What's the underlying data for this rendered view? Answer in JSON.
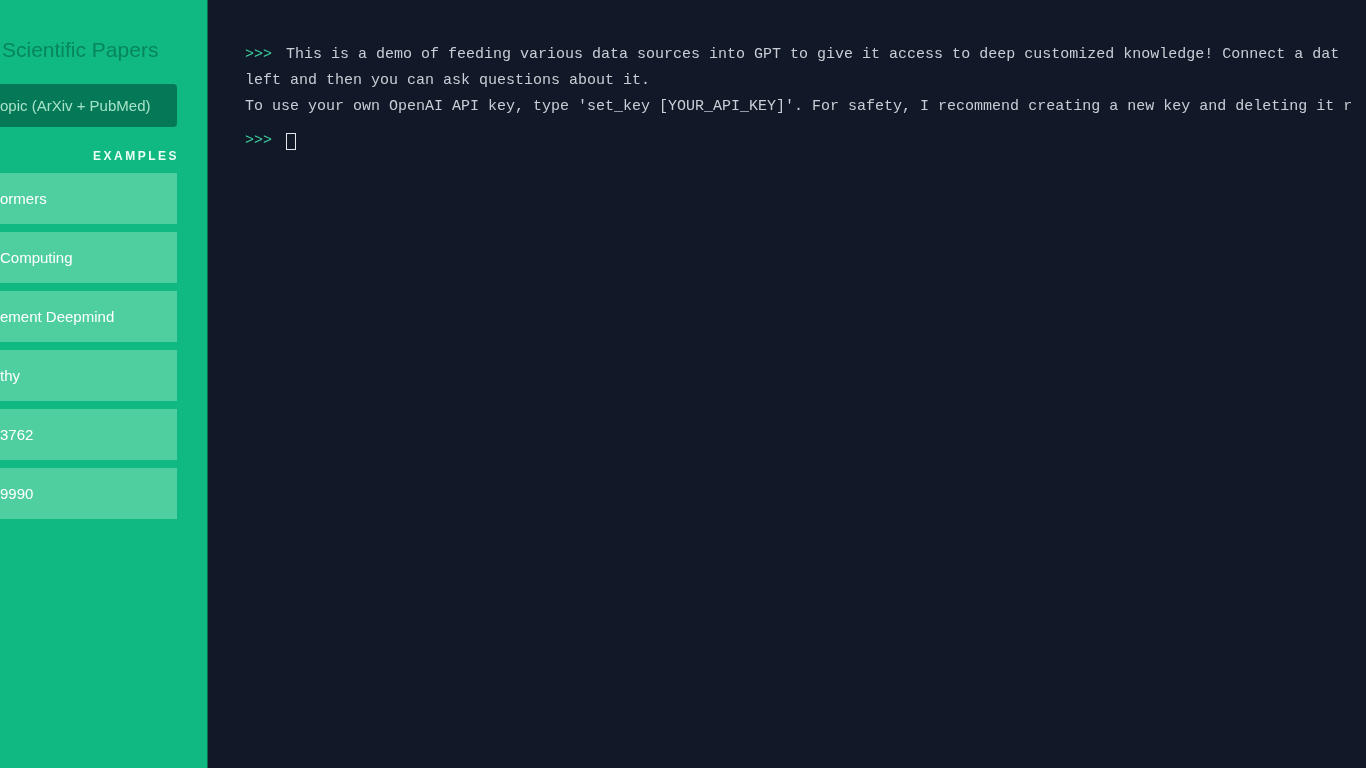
{
  "sidebar": {
    "title": "Scientific Papers",
    "source_button": "opic (ArXiv + PubMed)",
    "examples_heading": "EXAMPLES",
    "examples": [
      "ormers",
      "Computing",
      "ement Deepmind",
      "thy",
      "3762",
      "9990"
    ]
  },
  "terminal": {
    "prompt": ">>>",
    "lines": [
      {
        "kind": "prompted",
        "text": "This is a demo of feeding various data sources into GPT to give it access to deep customized knowledge! Connect a dat"
      },
      {
        "kind": "plain",
        "text": "left and then you can ask questions about it."
      },
      {
        "kind": "plain",
        "text": "To use your own OpenAI API key, type 'set_key [YOUR_API_KEY]'. For safety, I recommend creating a new key and deleting it r"
      }
    ],
    "input_prompt": ">>>"
  }
}
